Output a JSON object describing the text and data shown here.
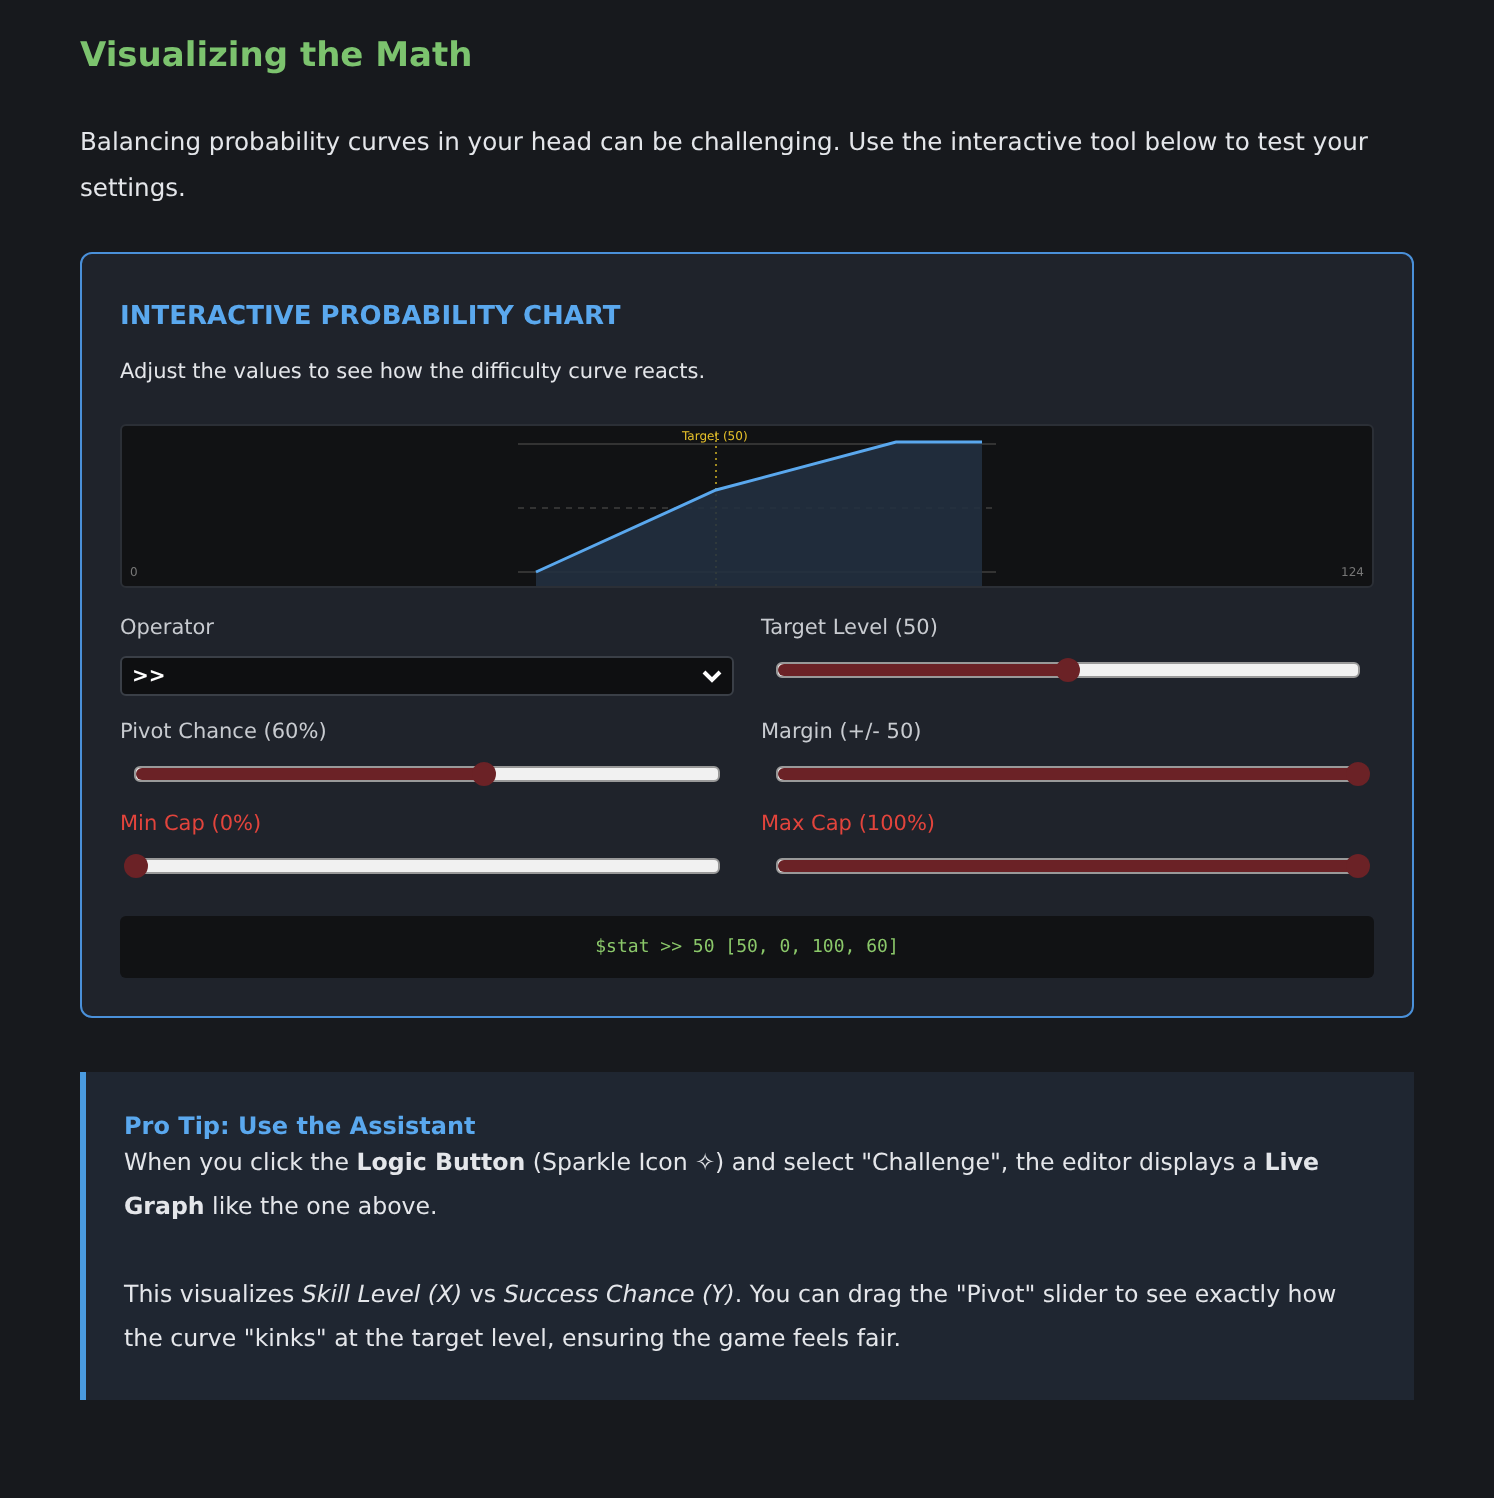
{
  "section": {
    "title": "Visualizing the Math",
    "intro": "Balancing probability curves in your head can be challenging. Use the interactive tool below to test your settings."
  },
  "card": {
    "title": "INTERACTIVE PROBABILITY CHART",
    "subtitle": "Adjust the values to see how the difficulty curve reacts.",
    "graph": {
      "target_label": "Target (50)",
      "x_start": "0",
      "x_end": "124"
    },
    "controls": [
      {
        "kind": "select",
        "label": "Operator",
        "value": ">>",
        "alert": false
      },
      {
        "kind": "slider",
        "label": "Target Level (50)",
        "level": 0.5,
        "alert": false
      },
      {
        "kind": "slider",
        "label": "Pivot Chance (60%)",
        "level": 0.6,
        "alert": false
      },
      {
        "kind": "slider",
        "label": "Margin (+/- 50)",
        "level": 1,
        "alert": false
      },
      {
        "kind": "slider",
        "label": "Min Cap (0%)",
        "level": 0,
        "alert": true
      },
      {
        "kind": "slider",
        "label": "Max Cap (100%)",
        "level": 1,
        "alert": true
      }
    ],
    "output": "$stat >> 50 [50, 0, 100, 60]"
  },
  "tip": {
    "title": "Pro Tip: Use the Assistant",
    "paragraphs": [
      "When you click the **Logic Button** (Sparkle Icon ✧) and select \"Challenge\", the editor displays a **Live Graph** like the one above.",
      "This visualizes *Skill Level (X)* vs *Success Chance (Y)*. You can drag the \"Pivot\" slider to see exactly how the curve \"kinks\" at the target level, ensuring the game feels fair."
    ]
  }
}
